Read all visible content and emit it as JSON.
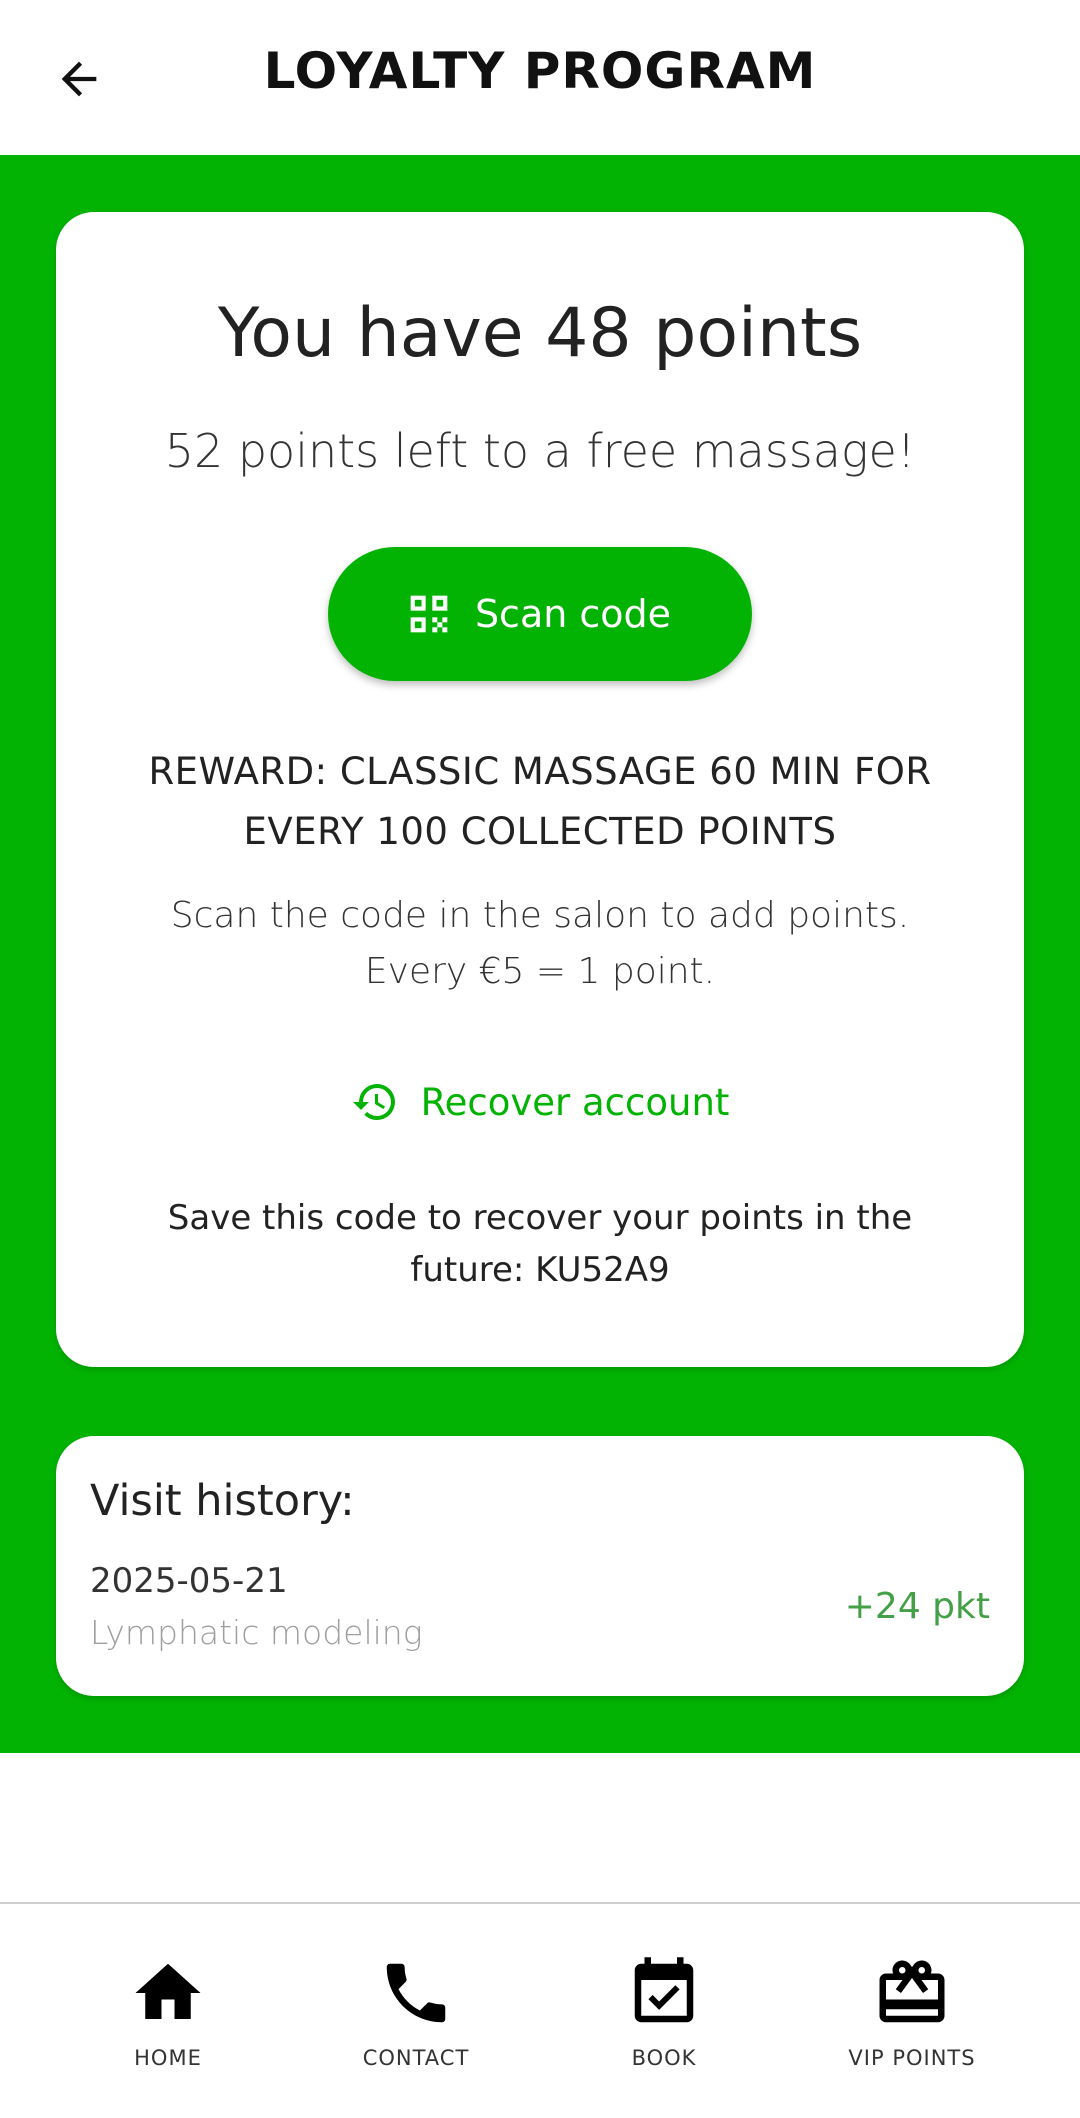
{
  "header": {
    "title": "LOYALTY PROGRAM"
  },
  "loyalty": {
    "points_title": "You have 48 points",
    "points_left": "52 points left to a free massage!",
    "scan_label": "Scan code",
    "reward_line1": "REWARD: CLASSIC MASSAGE 60 MIN FOR",
    "reward_line2": "EVERY 100 COLLECTED POINTS",
    "instructions_line1": "Scan the code in the salon to add points.",
    "instructions_line2": "Every €5 = 1 point.",
    "recover_label": "Recover account",
    "save_line1": "Save this code to recover your points in the",
    "save_line2": "future: KU52A9"
  },
  "history": {
    "title": "Visit history:",
    "entries": [
      {
        "date": "2025-05-21",
        "service": "Lymphatic modeling",
        "points": "+24 pkt"
      }
    ]
  },
  "nav": {
    "items": [
      {
        "label": "HOME",
        "icon": "home-icon"
      },
      {
        "label": "CONTACT",
        "icon": "phone-icon"
      },
      {
        "label": "BOOK",
        "icon": "calendar-check-icon"
      },
      {
        "label": "VIP POINTS",
        "icon": "gift-card-icon"
      }
    ]
  },
  "colors": {
    "accent": "#02b303",
    "points_positive": "#43a047",
    "muted": "#9e9e9e"
  }
}
